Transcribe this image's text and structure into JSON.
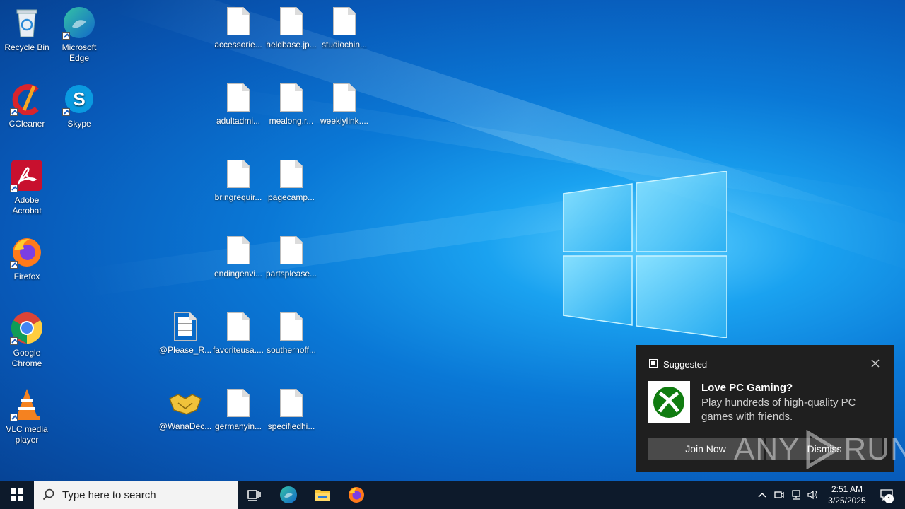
{
  "desktop": {
    "shortcuts": [
      {
        "label": "Recycle Bin",
        "icon": "recycle-bin-icon"
      },
      {
        "label": "Microsoft Edge",
        "icon": "edge-icon"
      },
      {
        "label": "CCleaner",
        "icon": "ccleaner-icon"
      },
      {
        "label": "Skype",
        "icon": "skype-icon"
      },
      {
        "label": "Adobe Acrobat",
        "icon": "acrobat-icon"
      },
      {
        "label": "Firefox",
        "icon": "firefox-icon"
      },
      {
        "label": "Google Chrome",
        "icon": "chrome-icon"
      },
      {
        "label": "VLC media player",
        "icon": "vlc-icon"
      }
    ],
    "files": [
      {
        "label": "accessorie...",
        "icon": "file-icon"
      },
      {
        "label": "heldbase.jp...",
        "icon": "file-icon"
      },
      {
        "label": "studiochin...",
        "icon": "file-icon"
      },
      {
        "label": "adultadmi...",
        "icon": "file-icon"
      },
      {
        "label": "mealong.r...",
        "icon": "file-icon"
      },
      {
        "label": "weeklylink....",
        "icon": "file-icon"
      },
      {
        "label": "bringrequir...",
        "icon": "file-icon"
      },
      {
        "label": "pagecamp...",
        "icon": "file-icon"
      },
      {
        "label": "endingenvi...",
        "icon": "file-icon"
      },
      {
        "label": "partsplease...",
        "icon": "file-icon"
      },
      {
        "label": "@Please_R...",
        "icon": "text-file-icon"
      },
      {
        "label": "favoriteusa....",
        "icon": "file-icon"
      },
      {
        "label": "southernoff...",
        "icon": "file-icon"
      },
      {
        "label": "@WanaDec...",
        "icon": "handshake-icon"
      },
      {
        "label": "germanyin...",
        "icon": "file-icon"
      },
      {
        "label": "specifiedhi...",
        "icon": "file-icon"
      }
    ]
  },
  "notification": {
    "header": "Suggested",
    "title": "Love PC Gaming?",
    "body": "Play hundreds of high-quality PC games with friends.",
    "primary_button": "Join Now",
    "secondary_button": "Dismiss",
    "app_icon": "xbox-icon"
  },
  "watermark": {
    "text_left": "ANY",
    "text_right": "RUN"
  },
  "taskbar": {
    "search_placeholder": "Type here to search",
    "pinned": [
      "task-view-icon",
      "edge-icon",
      "file-explorer-icon",
      "firefox-icon"
    ],
    "clock_time": "2:51 AM",
    "clock_date": "3/25/2025",
    "notification_count": "1"
  },
  "colors": {
    "taskbar": "#0d1a2b",
    "toast_bg": "#1f1f1f",
    "toast_button": "#4a4a4a",
    "wallpaper_accent": "#1aa2f0"
  }
}
